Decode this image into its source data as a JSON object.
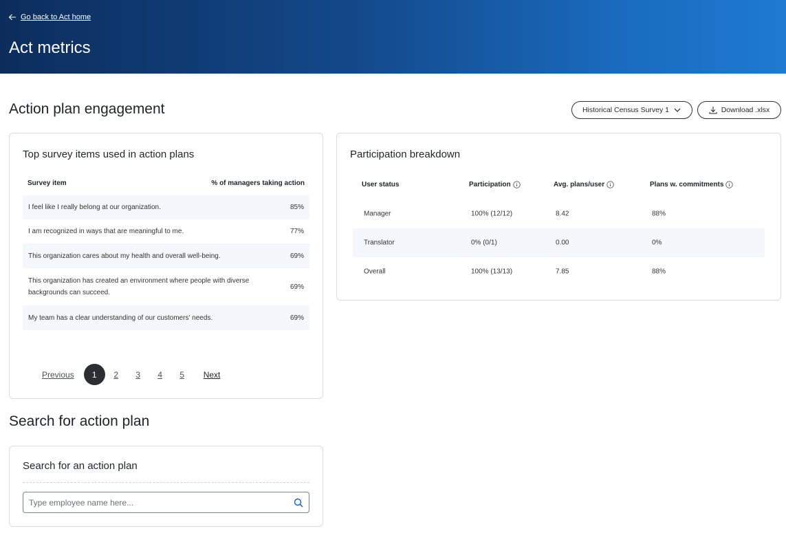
{
  "header": {
    "back_label": "Go back to Act home",
    "title": "Act metrics"
  },
  "engagement": {
    "title": "Action plan engagement",
    "survey_select": "Historical Census Survey 1",
    "download_label": "Download .xlsx"
  },
  "top_items": {
    "title": "Top survey items used in action plans",
    "col_item": "Survey item",
    "col_pct": "% of managers taking action",
    "rows": [
      {
        "item": "I feel like I really belong at our organization.",
        "pct": "85%"
      },
      {
        "item": "I am recognized in ways that are meaningful to me.",
        "pct": "77%"
      },
      {
        "item": "This organization cares about my health and overall well-being.",
        "pct": "69%"
      },
      {
        "item": "This organization has created an environment where people with diverse backgrounds can succeed.",
        "pct": "69%"
      },
      {
        "item": "My team has a clear understanding of our customers' needs.",
        "pct": "69%"
      }
    ],
    "pagination": {
      "previous": "Previous",
      "next": "Next",
      "pages": [
        "1",
        "2",
        "3",
        "4",
        "5"
      ],
      "current": "1"
    }
  },
  "participation": {
    "title": "Participation breakdown",
    "col_status": "User status",
    "col_participation": "Participation",
    "col_avg": "Avg. plans/user",
    "col_commit": "Plans w. commitments",
    "rows": [
      {
        "status": "Manager",
        "participation": "100% (12/12)",
        "avg": "8.42",
        "commit": "88%"
      },
      {
        "status": "Translator",
        "participation": "0% (0/1)",
        "avg": "0.00",
        "commit": "0%"
      },
      {
        "status": "Overall",
        "participation": "100% (13/13)",
        "avg": "7.85",
        "commit": "88%"
      }
    ]
  },
  "search": {
    "section_title": "Search for action plan",
    "card_title": "Search for an action plan",
    "placeholder": "Type employee name here..."
  }
}
